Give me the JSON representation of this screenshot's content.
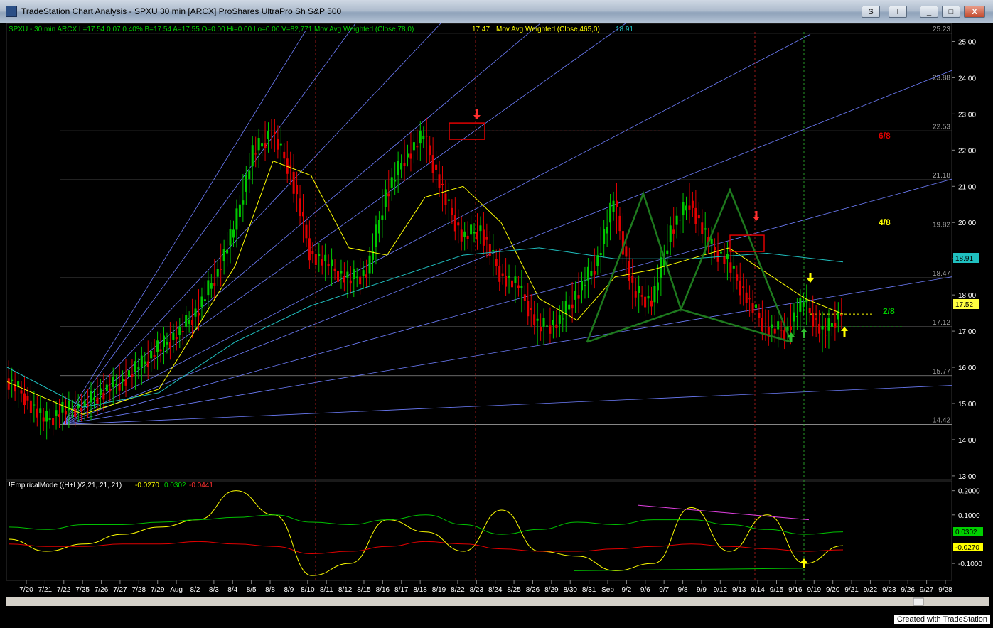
{
  "window": {
    "title": "TradeStation Chart Analysis - SPXU 30 min [ARCX] ProShares UltraPro Sh S&P 500",
    "btn_s": "S",
    "btn_i": "I",
    "btn_min": "_",
    "btn_max": "□",
    "btn_close": "X"
  },
  "header": {
    "symbol_info": "SPXU - 30 min  ARCX  L=17.54  0.07  0.40%  B=17.54  A=17.55  O=0.00  Hi=0.00  Lo=0.00  V=82,771  Mov Avg Weighted (Close,78,0)",
    "ma78_value": "17.47",
    "ma465_label": "Mov Avg Weighted (Close,465,0)",
    "ma465_value": "18.91"
  },
  "indicator": {
    "label": "!EmpiricalMode ((H+L)/2,21,.21,.21)",
    "v1": "-0.0270",
    "v2": "0.0302",
    "v3": "-0.0441"
  },
  "fib": {
    "label_68": "6/8",
    "label_48": "4/8",
    "label_28": "2/8"
  },
  "footer": "Created with TradeStation",
  "colors": {
    "background": "#000000",
    "up_bar": "#00c800",
    "down_bar": "#e00000",
    "ma78": "#ffff00",
    "ma465": "#20c0c0",
    "fan": "#6f7fff",
    "pattern": "#1e7a1e"
  },
  "chart_data": [
    {
      "type": "line",
      "title": "",
      "ylim": [
        12.9,
        25.5
      ],
      "y_ticks": [
        "25.00",
        "24.00",
        "23.00",
        "22.00",
        "21.00",
        "20.00",
        "19.00",
        "18.00",
        "17.00",
        "16.00",
        "15.00",
        "14.00",
        "13.00"
      ],
      "x_ticks": [
        "7/20",
        "7/21",
        "7/22",
        "7/25",
        "7/26",
        "7/27",
        "7/28",
        "7/29",
        "Aug",
        "8/2",
        "8/3",
        "8/4",
        "8/5",
        "8/8",
        "8/9",
        "8/10",
        "8/11",
        "8/12",
        "8/15",
        "8/16",
        "8/17",
        "8/18",
        "8/19",
        "8/22",
        "8/23",
        "8/24",
        "8/25",
        "8/26",
        "8/29",
        "8/30",
        "8/31",
        "Sep",
        "9/2",
        "9/6",
        "9/7",
        "9/8",
        "9/9",
        "9/12",
        "9/13",
        "9/14",
        "9/15",
        "9/16",
        "9/19",
        "9/20",
        "9/21",
        "9/22",
        "9/23",
        "9/26",
        "9/27",
        "9/28"
      ],
      "levels": [
        "25.23",
        "23.88",
        "22.53",
        "21.18",
        "19.82",
        "18.47",
        "17.12",
        "15.77",
        "14.42"
      ],
      "series": [
        {
          "name": "SPXU",
          "x": [
            0,
            1,
            2,
            3,
            4,
            5,
            6,
            7,
            8,
            9,
            10,
            11,
            12,
            13,
            14,
            15,
            16,
            17,
            18,
            19,
            20,
            21,
            22,
            23,
            24,
            25,
            26,
            27,
            28,
            29,
            30,
            31,
            32,
            33,
            34,
            35,
            36,
            37,
            38,
            39,
            40,
            41,
            42,
            43,
            44
          ],
          "values": [
            15.7,
            15.2,
            14.5,
            14.8,
            14.9,
            15.3,
            15.6,
            16.0,
            16.5,
            16.9,
            17.5,
            18.5,
            19.8,
            21.9,
            22.5,
            21.4,
            19.2,
            18.8,
            18.4,
            18.6,
            20.8,
            21.8,
            22.4,
            20.8,
            19.6,
            19.8,
            18.6,
            18.2,
            17.1,
            17.2,
            18.0,
            18.8,
            20.6,
            18.1,
            17.8,
            19.8,
            20.6,
            19.4,
            18.9,
            17.9,
            17.1,
            17.0,
            17.8,
            16.9,
            17.54
          ]
        },
        {
          "name": "Mov Avg Weighted (Close,78,0)",
          "x": [
            0,
            4,
            8,
            12,
            14,
            16,
            18,
            20,
            22,
            24,
            26,
            28,
            30,
            32,
            34,
            36,
            38,
            40,
            42,
            44
          ],
          "values": [
            15.6,
            14.7,
            15.4,
            18.8,
            21.7,
            21.3,
            19.3,
            19.1,
            20.7,
            21.0,
            20.0,
            17.9,
            17.3,
            18.5,
            18.7,
            19.0,
            19.3,
            18.6,
            17.9,
            17.47
          ]
        },
        {
          "name": "Mov Avg Weighted (Close,465,0)",
          "x": [
            0,
            4,
            8,
            12,
            16,
            20,
            24,
            28,
            32,
            36,
            40,
            44
          ],
          "values": [
            16.0,
            14.9,
            15.3,
            16.7,
            17.7,
            18.4,
            19.1,
            19.3,
            19.0,
            19.0,
            19.15,
            18.91
          ]
        }
      ]
    },
    {
      "type": "line",
      "title": "",
      "ylim": [
        -0.17,
        0.24
      ],
      "y_ticks": [
        "0.2000",
        "0.1000",
        "-0.1000"
      ],
      "series": [
        {
          "name": "-0.0270",
          "values": [
            0.0,
            -0.05,
            -0.02,
            0.02,
            0.05,
            0.08,
            0.2,
            0.1,
            -0.15,
            -0.1,
            0.08,
            0.03,
            -0.05,
            0.12,
            -0.05,
            -0.07,
            -0.13,
            -0.1,
            0.13,
            -0.05,
            0.1,
            -0.1,
            -0.027
          ]
        },
        {
          "name": "0.0302",
          "values": [
            0.05,
            0.04,
            0.06,
            0.06,
            0.07,
            0.08,
            0.09,
            0.1,
            0.07,
            0.06,
            0.08,
            0.1,
            0.06,
            0.02,
            0.04,
            0.07,
            0.06,
            0.08,
            0.08,
            0.06,
            0.04,
            0.02,
            0.0302
          ]
        },
        {
          "name": "-0.0441",
          "values": [
            -0.02,
            -0.03,
            -0.03,
            -0.02,
            -0.02,
            -0.01,
            -0.02,
            -0.03,
            -0.06,
            -0.05,
            -0.03,
            -0.01,
            -0.02,
            -0.04,
            -0.05,
            -0.05,
            -0.04,
            -0.03,
            -0.02,
            -0.03,
            -0.04,
            -0.05,
            -0.0441
          ]
        }
      ]
    }
  ]
}
